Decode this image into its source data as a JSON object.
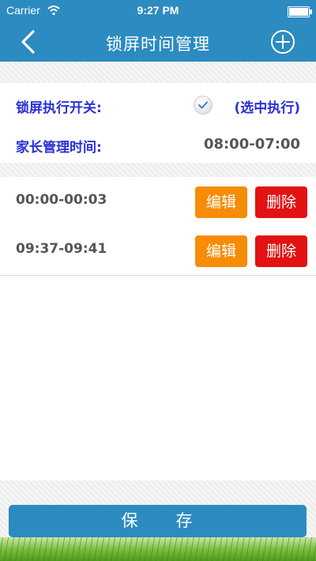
{
  "status_bar": {
    "carrier": "Carrier",
    "time": "9:27 PM"
  },
  "nav": {
    "title": "锁屏时间管理",
    "back_icon": "chevron-left-icon",
    "add_icon": "add-circle-icon"
  },
  "settings": {
    "lock_switch_label": "锁屏执行开关:",
    "lock_switch_checked": true,
    "lock_switch_note": "(选中执行)",
    "parent_time_label": "家长管理时间:",
    "parent_time_value": "08:00-07:00"
  },
  "schedules": [
    {
      "time": "00:00-00:03",
      "edit": "编辑",
      "delete": "删除"
    },
    {
      "time": "09:37-09:41",
      "edit": "编辑",
      "delete": "删除"
    }
  ],
  "save_label": "保　　存",
  "colors": {
    "accent": "#2c8bc0",
    "edit": "#f68c08",
    "delete": "#e31212",
    "label": "#2b30d8"
  }
}
